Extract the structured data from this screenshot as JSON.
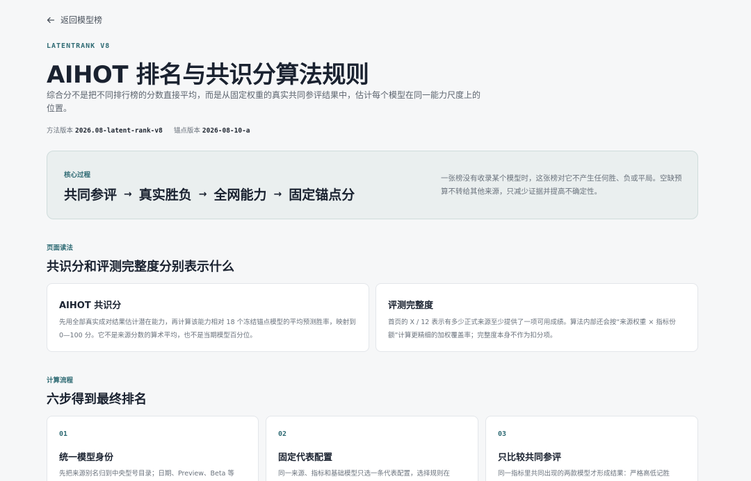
{
  "nav": {
    "back_label": "返回模型榜"
  },
  "header": {
    "eyebrow": "LATENTRANK V8",
    "title": "AIHOT 排名与共识分算法规则",
    "subtitle": "综合分不是把不同排行榜的分数直接平均，而是从固定权重的真实共同参评结果中，估计每个模型在同一能力尺度上的位置。",
    "method_version_label": "方法版本",
    "method_version_value": "2026.08-latent-rank-v8",
    "anchor_version_label": "锚点版本",
    "anchor_version_value": "2026-08-10-a"
  },
  "core": {
    "label": "核心过程",
    "steps": [
      "共同参评",
      "真实胜负",
      "全网能力",
      "固定锚点分"
    ],
    "arrow": "→",
    "note": "一张榜没有收录某个模型时，这张榜对它不产生任何胜、负或平局。空缺预算不转给其他来源，只减少证据并提高不确定性。"
  },
  "reading": {
    "eyebrow": "页面读法",
    "title": "共识分和评测完整度分别表示什么",
    "cards": [
      {
        "title": "AIHOT 共识分",
        "body": "先用全部真实成对结果估计潜在能力，再计算该能力相对 18 个冻结锚点模型的平均预测胜率，映射到 0—100 分。它不是来源分数的算术平均，也不是当期模型百分位。"
      },
      {
        "title": "评测完整度",
        "body": "首页的 X / 12 表示有多少正式来源至少提供了一项可用成绩。算法内部还会按“来源权重 × 指标份额”计算更精细的加权覆盖率；完整度本身不作为扣分项。"
      }
    ]
  },
  "process": {
    "eyebrow": "计算流程",
    "title": "六步得到最终排名",
    "steps": [
      {
        "num": "01",
        "title": "统一模型身份",
        "body": "先把来源别名归到中央型号目录；日期、Preview、Beta 等"
      },
      {
        "num": "02",
        "title": "固定代表配置",
        "body": "同一来源、指标和基础模型只选一条代表配置，选择规则在"
      },
      {
        "num": "03",
        "title": "只比较共同参评",
        "body": "同一指标里共同出现的两款模型才形成结果：严格高低记胜"
      }
    ]
  }
}
